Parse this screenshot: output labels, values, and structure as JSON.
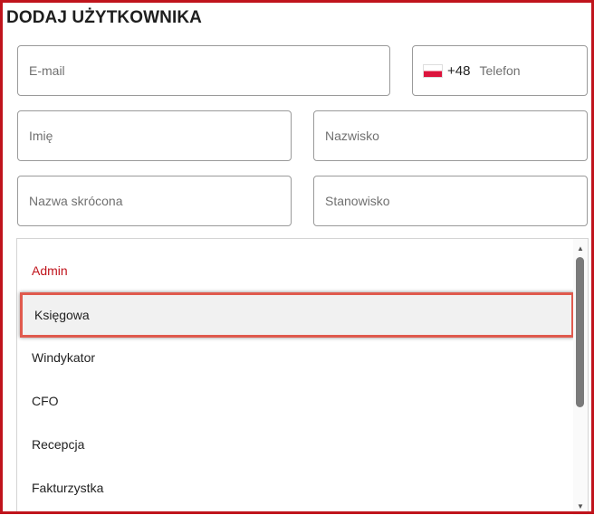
{
  "title": "DODAJ UŻYTKOWNIKA",
  "form": {
    "email_placeholder": "E-mail",
    "phone_prefix": "+48",
    "phone_placeholder": "Telefon",
    "first_name_placeholder": "Imię",
    "last_name_placeholder": "Nazwisko",
    "short_name_placeholder": "Nazwa skrócona",
    "position_placeholder": "Stanowisko"
  },
  "role_list": {
    "options": [
      {
        "label": "Admin",
        "state": "selected"
      },
      {
        "label": "Księgowa",
        "state": "highlighted"
      },
      {
        "label": "Windykator",
        "state": "normal"
      },
      {
        "label": "CFO",
        "state": "normal"
      },
      {
        "label": "Recepcja",
        "state": "normal"
      },
      {
        "label": "Fakturzystka",
        "state": "normal"
      }
    ]
  },
  "colors": {
    "accent": "#c0141c",
    "highlight_border": "#e05a4e",
    "highlight_bg": "#f1f1f1"
  },
  "icons": [
    "poland-flag-icon",
    "scroll-up-arrow-icon",
    "scroll-down-arrow-icon"
  ]
}
